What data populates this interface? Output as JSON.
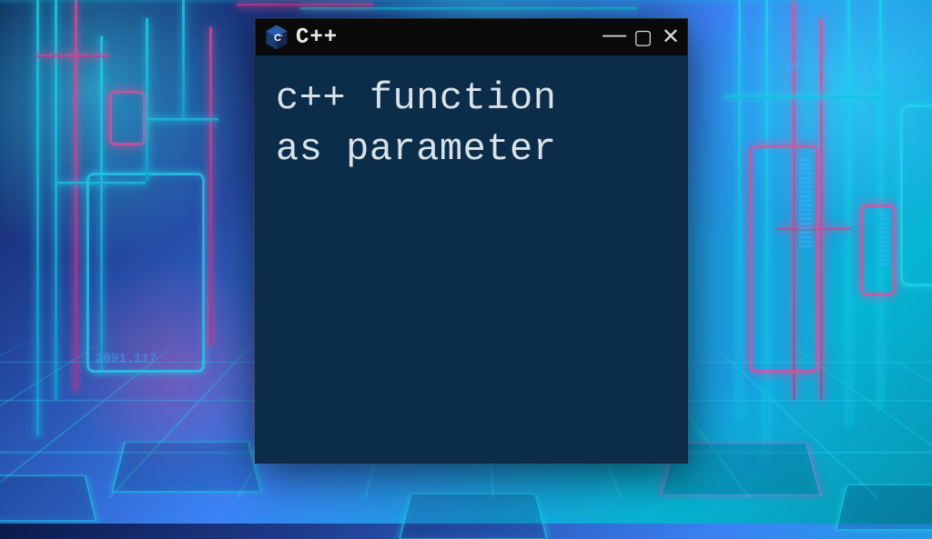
{
  "window": {
    "title": "C++",
    "icon_name": "cpp-hexagon-icon",
    "content_text": "c++ function\nas parameter"
  },
  "background": {
    "decorative_text_1": "10 0111 : 307  cenven",
    "decorative_text_2": "2091.117"
  },
  "controls": {
    "minimize_glyph": "—",
    "maximize_glyph": "▢",
    "close_glyph": "✕"
  },
  "colors": {
    "console_bg": "#0b2d4a",
    "titlebar_bg": "#0a0a0a",
    "text": "#d9e2e8",
    "neon_cyan": "#22d3ee",
    "neon_pink": "#ec4899"
  }
}
